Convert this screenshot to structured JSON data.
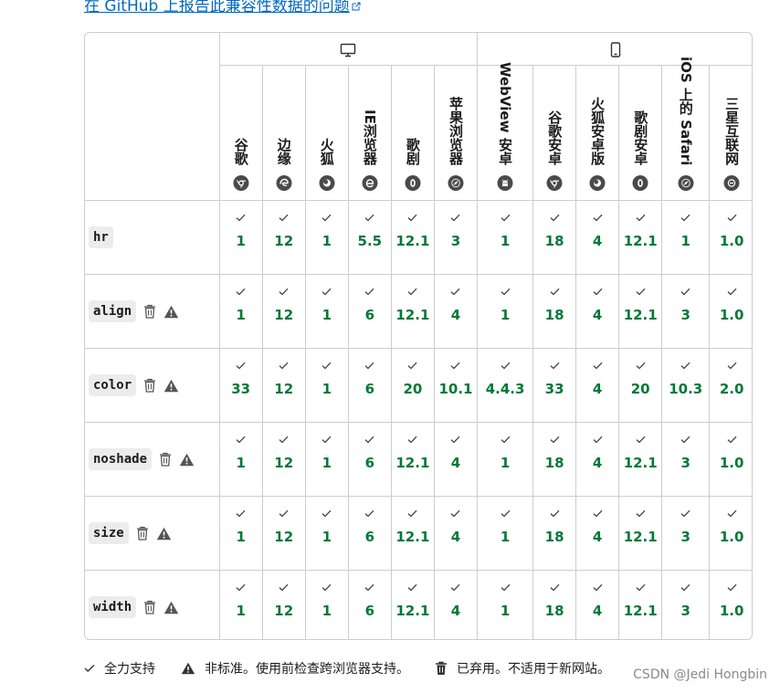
{
  "top_link": {
    "text": "在 GitHub 上报告此兼容性数据的问题"
  },
  "platforms": [
    {
      "name": "desktop-icon",
      "span": 6
    },
    {
      "name": "mobile-icon",
      "span": 6
    }
  ],
  "browsers": [
    {
      "name": "桌面 Chrome",
      "label": "谷歌",
      "icon": "chrome-icon"
    },
    {
      "name": "Edge",
      "label": "边缘",
      "icon": "edge-icon"
    },
    {
      "name": "Firefox",
      "label": "火狐",
      "icon": "firefox-icon"
    },
    {
      "name": "IE",
      "label": "IE浏览器",
      "icon": "ie-icon"
    },
    {
      "name": "Opera",
      "label": "歌剧",
      "icon": "opera-icon"
    },
    {
      "name": "Safari",
      "label": "苹果浏览器",
      "icon": "safari-icon"
    },
    {
      "name": "WebView",
      "label": "WebView 安卓",
      "icon": "android-icon"
    },
    {
      "name": "Chrome Android",
      "label": "谷歌安卓",
      "icon": "chrome-icon"
    },
    {
      "name": "Firefox Android",
      "label": "火狐安卓版",
      "icon": "firefox-icon"
    },
    {
      "name": "Opera Android",
      "label": "歌剧安卓",
      "icon": "opera-icon"
    },
    {
      "name": "iOS Safari",
      "label": "iOS 上的 Safari",
      "icon": "safari-icon"
    },
    {
      "name": "Samsung Internet",
      "label": "三星互联网",
      "icon": "samsung-icon"
    }
  ],
  "features": [
    {
      "code": "hr",
      "deprecated": false,
      "nonstandard": false,
      "versions": [
        "1",
        "12",
        "1",
        "5.5",
        "12.1",
        "3",
        "1",
        "18",
        "4",
        "12.1",
        "1",
        "1.0"
      ]
    },
    {
      "code": "align",
      "deprecated": true,
      "nonstandard": true,
      "versions": [
        "1",
        "12",
        "1",
        "6",
        "12.1",
        "4",
        "1",
        "18",
        "4",
        "12.1",
        "3",
        "1.0"
      ]
    },
    {
      "code": "color",
      "deprecated": true,
      "nonstandard": true,
      "versions": [
        "33",
        "12",
        "1",
        "6",
        "20",
        "10.1",
        "4.4.3",
        "33",
        "4",
        "20",
        "10.3",
        "2.0"
      ]
    },
    {
      "code": "noshade",
      "deprecated": true,
      "nonstandard": true,
      "versions": [
        "1",
        "12",
        "1",
        "6",
        "12.1",
        "4",
        "1",
        "18",
        "4",
        "12.1",
        "3",
        "1.0"
      ]
    },
    {
      "code": "size",
      "deprecated": true,
      "nonstandard": true,
      "versions": [
        "1",
        "12",
        "1",
        "6",
        "12.1",
        "4",
        "1",
        "18",
        "4",
        "12.1",
        "3",
        "1.0"
      ]
    },
    {
      "code": "width",
      "deprecated": true,
      "nonstandard": true,
      "versions": [
        "1",
        "12",
        "1",
        "6",
        "12.1",
        "4",
        "1",
        "18",
        "4",
        "12.1",
        "3",
        "1.0"
      ]
    }
  ],
  "legend": {
    "full_support": "全力支持",
    "non_standard": "非标准。使用前检查跨浏览器支持。",
    "deprecated": "已弃用。不适用于新网站。"
  },
  "watermark": "CSDN @Jedi Hongbin",
  "colors": {
    "version": "#007936",
    "link": "#0069c2",
    "border": "#cdcdcd"
  }
}
